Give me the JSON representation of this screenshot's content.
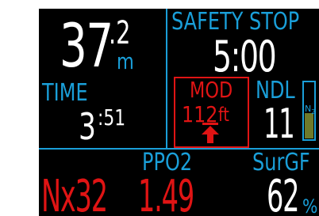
{
  "depth": {
    "whole": "37",
    "decimal": ".2",
    "unit": "m"
  },
  "time": {
    "label": "TIME",
    "minutes": "3",
    "seconds": ":51"
  },
  "safety_stop": {
    "label": "SAFETY STOP",
    "value": "5:00"
  },
  "mod": {
    "label": "MOD",
    "value": "112",
    "unit": "ft"
  },
  "ndl": {
    "label": "NDL",
    "value": "11"
  },
  "tissue_bar": {
    "label_main": "N",
    "label_sub": "2",
    "fill_fraction": 0.45
  },
  "ppo2": {
    "label": "PPO2",
    "gas": "Nx32",
    "value": "1.49"
  },
  "surgf": {
    "label": "SurGF",
    "value": "62",
    "unit": "%"
  },
  "colors": {
    "background": "#000000",
    "accent_blue": "#1a9fd9",
    "warning_red": "#e01414",
    "value_white": "#ffffff",
    "tissue_green": "#6e7a2a"
  }
}
